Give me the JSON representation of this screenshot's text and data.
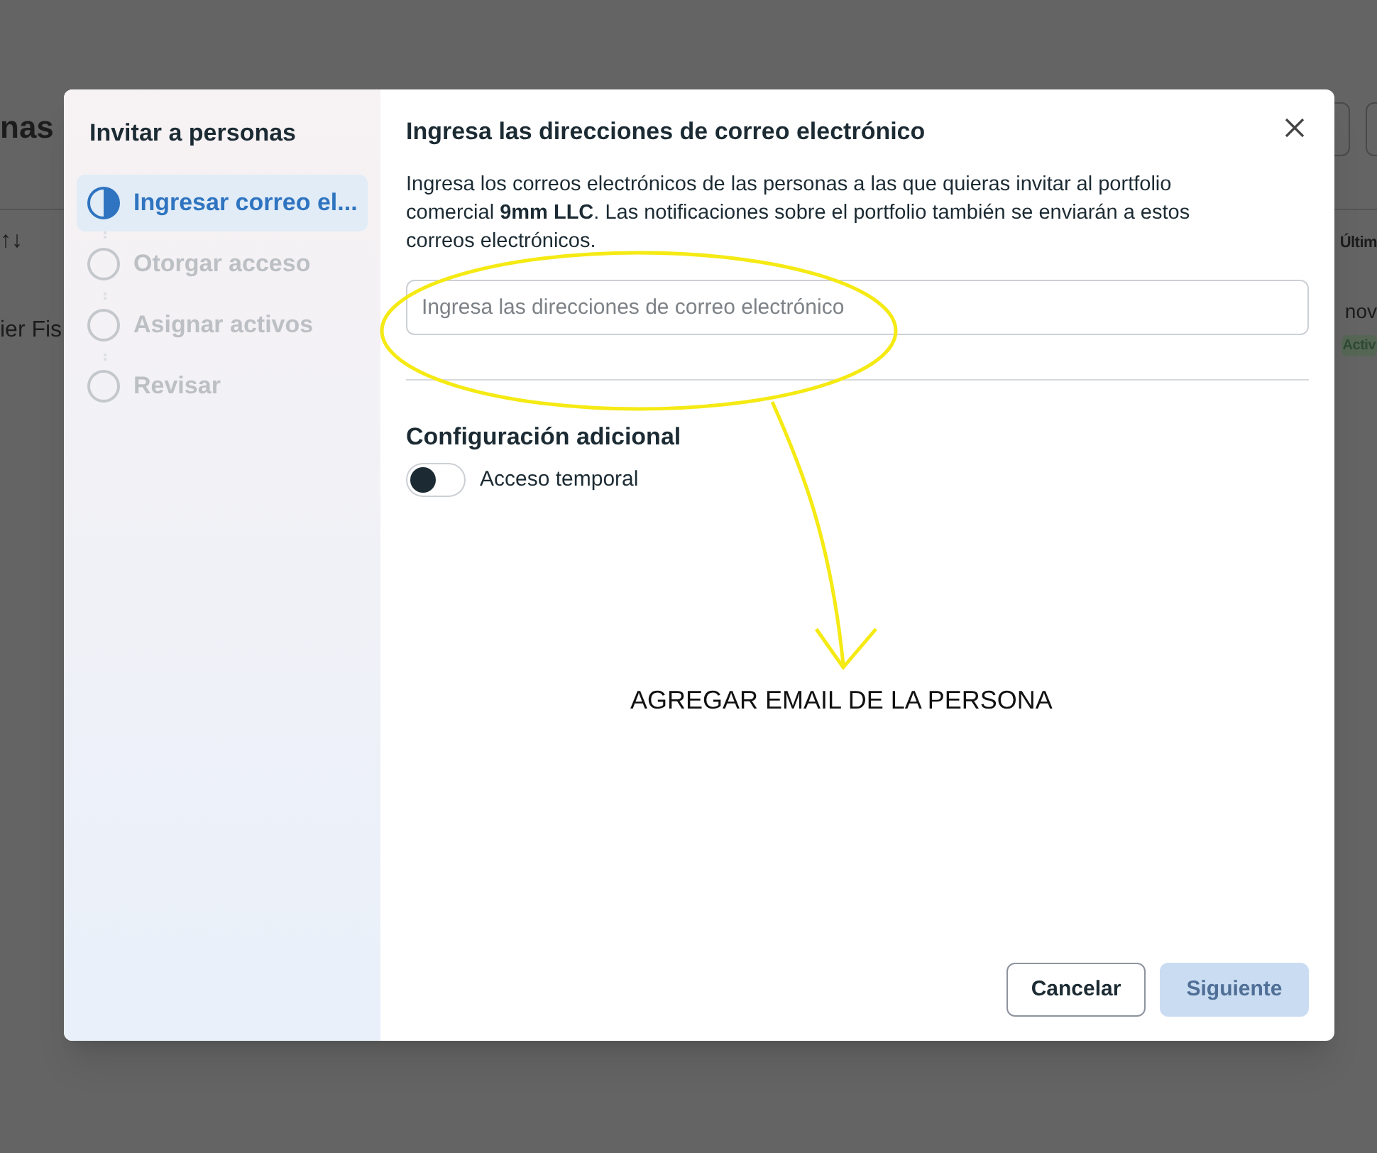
{
  "background_page": {
    "title_fragment": "nas",
    "sort_fragment": "↑↓",
    "name_fragment": "ier Fis",
    "column_fragment": "Últim",
    "date_fragment": "nov",
    "status_fragment": "Activ"
  },
  "dialog": {
    "sidebar": {
      "title": "Invitar a personas",
      "steps": [
        {
          "label": "Ingresar correo el...",
          "selected": true
        },
        {
          "label": "Otorgar acceso",
          "selected": false
        },
        {
          "label": "Asignar activos",
          "selected": false
        },
        {
          "label": "Revisar",
          "selected": false
        }
      ]
    },
    "title": "Ingresa las direcciones de correo electrónico",
    "description": "Ingresa los correos electrónicos de las personas a las que quieras invitar al portfolio comercial **9mm LLC**. Las notificaciones sobre el portfolio también se enviarán a estos correos electrónicos.",
    "email_field": {
      "placeholder": "Ingresa las direcciones de correo electrónico"
    },
    "section_title": "Configuración adicional",
    "toggle": {
      "label": "Acceso temporal",
      "on": false
    },
    "buttons": [
      {
        "label": "Cancelar",
        "disabled": false
      },
      {
        "label": "Siguiente",
        "disabled": true
      }
    ]
  },
  "annotation": {
    "text": "AGREGAR EMAIL DE LA PERSONA"
  }
}
